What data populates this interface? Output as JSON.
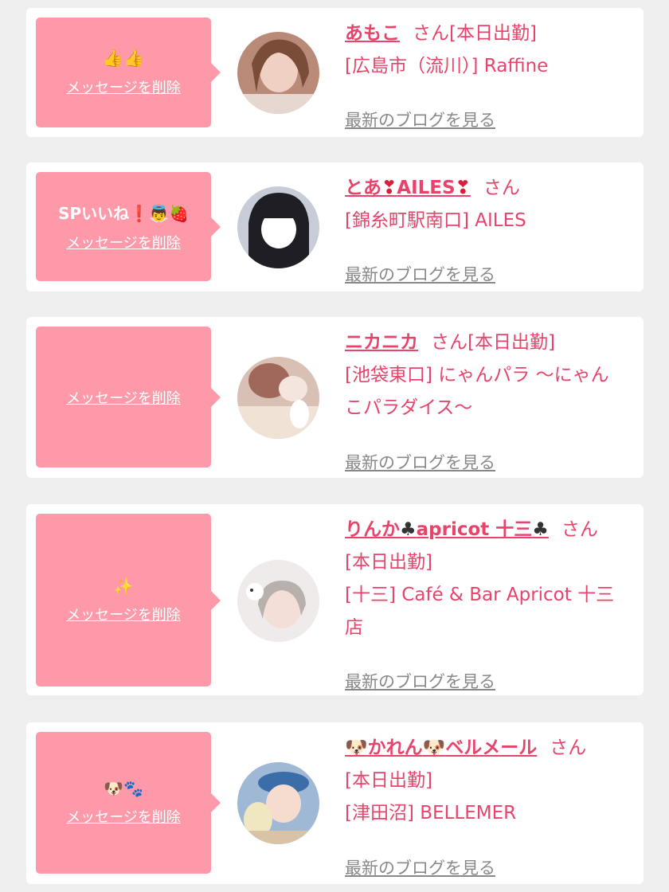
{
  "delete_label": "メッセージを削除",
  "blog_label": "最新のブログを見る",
  "san_label": "さん",
  "cards": [
    {
      "message": "👍👍",
      "name": "あもこ",
      "status": "[本日出勤]",
      "shop": "[広島市（流川）] Raffine"
    },
    {
      "message": "SPいいね❗👼🍓",
      "name_parts": [
        "とあ",
        "❣",
        "AILES",
        "❣"
      ],
      "status": "",
      "shop": "[錦糸町駅南口] AILES"
    },
    {
      "message": "",
      "name": "ニカニカ",
      "status": "[本日出勤]",
      "shop_line1": "[池袋東口] にゃんパラ 〜にゃん",
      "shop_line2": "こパラダイス〜"
    },
    {
      "message": "✨",
      "name_parts": [
        "りんか",
        "♣",
        "apricot 十三",
        "♣"
      ],
      "status": "[本日出勤]",
      "shop_line1": "[十三] Café & Bar Apricot 十三",
      "shop_line2": "店"
    },
    {
      "message": "🐶🐾",
      "name_parts": [
        "🐶",
        "かれん",
        "🐶",
        "ベルメール"
      ],
      "status": "[本日出勤]",
      "shop": "[津田沼] BELLEMER"
    }
  ],
  "colors": {
    "bubble": "#fd99a8",
    "accent": "#e8436b",
    "muted_link": "#888888",
    "background": "#efefef"
  }
}
